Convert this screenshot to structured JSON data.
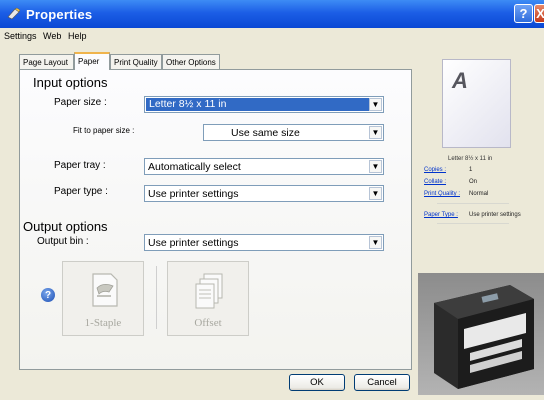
{
  "window": {
    "title": "Properties",
    "help_btn": "?",
    "close_btn": "X"
  },
  "menu": [
    "Settings",
    "Web",
    "Help"
  ],
  "tabs": [
    {
      "label": "Page Layout",
      "active": false
    },
    {
      "label": "Paper",
      "active": true
    },
    {
      "label": "Print Quality",
      "active": false
    },
    {
      "label": "Other Options",
      "active": false
    }
  ],
  "input_options": {
    "heading": "Input options",
    "paper_size": {
      "label": "Paper size :",
      "value": "Letter 8½ x 11 in"
    },
    "fit_to_paper_size": {
      "label": "Fit to paper size :",
      "value": "Use same size"
    },
    "paper_tray": {
      "label": "Paper tray :",
      "value": "Automatically select"
    },
    "paper_type": {
      "label": "Paper type :",
      "value": "Use printer settings"
    }
  },
  "output_options": {
    "heading": "Output options",
    "output_bin": {
      "label": "Output bin :",
      "value": "Use printer settings"
    },
    "staple_label": "1-Staple",
    "offset_label": "Offset"
  },
  "buttons": {
    "ok": "OK",
    "cancel": "Cancel"
  },
  "preview": {
    "page_letter": "A",
    "paper_summary": "Letter 8½ x 11 in",
    "rows": [
      {
        "key": "Copies :",
        "value": "1"
      },
      {
        "key": "Collate :",
        "value": "On"
      },
      {
        "key": "Print Quality :",
        "value": "Normal"
      },
      {
        "key": "Paper Type :",
        "value": "Use printer settings"
      }
    ]
  },
  "colors": {
    "titlebar": "#0a48d4",
    "selection": "#316ac5",
    "link": "#0033cc"
  }
}
